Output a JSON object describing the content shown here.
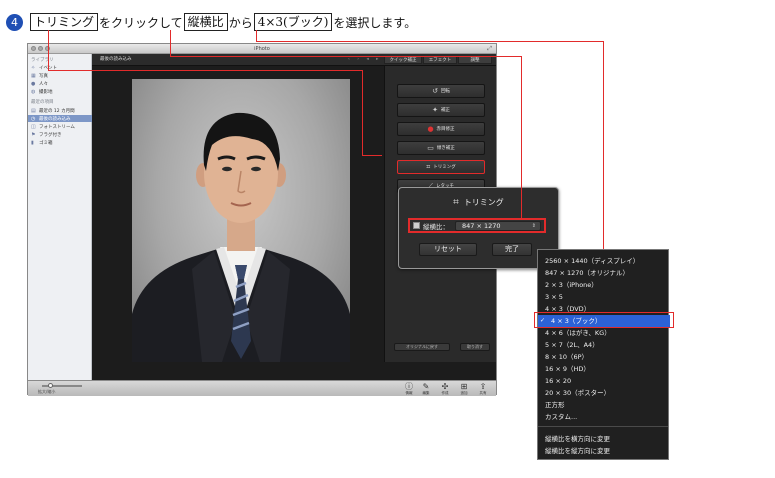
{
  "instruction": {
    "step_number": "4",
    "trim_key": "トリミング",
    "text1": "をクリックして",
    "aspect_key": "縦横比",
    "text2": "から",
    "option_key": "4×3(ブック)",
    "text3": "を選択します。"
  },
  "window": {
    "title": "iPhoto",
    "topbar_title": "最後の読み込み",
    "topbar_arrows": "‹ › ◂ ▸",
    "tabs": [
      "クイック補正",
      "エフェクト",
      "調整"
    ]
  },
  "sidebar": {
    "library_header": "ライブラリ",
    "library_items": [
      {
        "label": "イベント",
        "icon": "event-icon"
      },
      {
        "label": "写真",
        "icon": "photos-icon"
      },
      {
        "label": "人々",
        "icon": "people-icon"
      },
      {
        "label": "撮影地",
        "icon": "places-icon"
      }
    ],
    "recent_header": "最近の項目",
    "recent_items": [
      {
        "label": "最近の 12 カ月間",
        "icon": "calendar-icon"
      },
      {
        "label": "最後の読み込み",
        "icon": "import-icon"
      },
      {
        "label": "フォトストリーム",
        "icon": "photostream-icon"
      },
      {
        "label": "フラグ付き",
        "icon": "flag-icon"
      },
      {
        "label": "ゴミ箱",
        "icon": "trash-icon"
      }
    ]
  },
  "edit_panel": {
    "buttons": [
      {
        "label": "回転",
        "icon": "rotate-icon"
      },
      {
        "label": "補正",
        "icon": "enhance-icon"
      },
      {
        "label": "赤目修正",
        "icon": "red-eye-icon"
      },
      {
        "label": "傾き補正",
        "icon": "straighten-icon"
      },
      {
        "label": "トリミング",
        "icon": "crop-icon"
      },
      {
        "label": "レタッチ",
        "icon": "retouch-icon"
      }
    ],
    "revert_button": "オリジナルに戻す",
    "undo_button": "取り消す"
  },
  "bottom_bar": {
    "zoom_label": "拡大/縮小",
    "tools": [
      {
        "label": "情報",
        "icon": "info-icon"
      },
      {
        "label": "編集",
        "icon": "edit-icon"
      },
      {
        "label": "作成",
        "icon": "create-icon"
      },
      {
        "label": "追加",
        "icon": "add-icon"
      },
      {
        "label": "共有",
        "icon": "share-icon"
      }
    ]
  },
  "trim_popup": {
    "title": "トリミング",
    "aspect_label": "縦横比：",
    "aspect_value": "847 × 1270",
    "reset_button": "リセット",
    "done_button": "完了"
  },
  "aspect_menu": {
    "items": [
      "2560 × 1440（ディスプレイ）",
      "847 × 1270（オリジナル）",
      "2 × 3（iPhone）",
      "3 × 5",
      "4 × 3（DVD）",
      "4 × 3（ブック）",
      "4 × 6（はがき、KG）",
      "5 × 7（2L、A4）",
      "8 × 10（6P）",
      "16 × 9（HD）",
      "16 × 20",
      "20 × 30（ポスター）",
      "正方形",
      "カスタム..."
    ],
    "selected_index": 5,
    "check_mark": "✓",
    "orientation_items": [
      "縦横比を横方向に変更",
      "縦横比を縦方向に変更"
    ]
  },
  "colors": {
    "annotation_red": "#e22b2b",
    "menu_highlight": "#2c62d6",
    "step_badge": "#1f4fb4"
  }
}
